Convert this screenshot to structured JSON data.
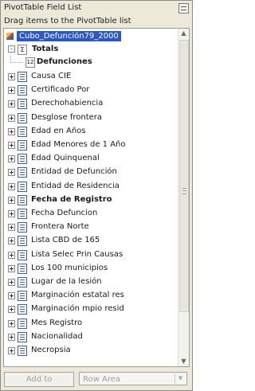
{
  "window": {
    "title": "PivotTable Field List",
    "instructions": "Drag items to the PivotTable list"
  },
  "tree": {
    "cube": "Cubo_Defunción79_2000",
    "totals": "Totals",
    "measure": "Defunciones",
    "fields": [
      {
        "label": "Causa CIE",
        "bold": false
      },
      {
        "label": "Certificado Por",
        "bold": false
      },
      {
        "label": "Derechohabiencia",
        "bold": false
      },
      {
        "label": "Desglose frontera",
        "bold": false
      },
      {
        "label": "Edad en Años",
        "bold": false
      },
      {
        "label": "Edad Menores de 1 Año",
        "bold": false
      },
      {
        "label": "Edad Quinquenal",
        "bold": false
      },
      {
        "label": "Entidad de Defunción",
        "bold": false
      },
      {
        "label": "Entidad de Residencia",
        "bold": false
      },
      {
        "label": "Fecha de Registro",
        "bold": true
      },
      {
        "label": "Fecha Defuncion",
        "bold": false
      },
      {
        "label": "Frontera Norte",
        "bold": false
      },
      {
        "label": "Lista CBD de 165",
        "bold": false
      },
      {
        "label": "Lista Selec Prin Causas",
        "bold": false
      },
      {
        "label": "Los 100 municipios",
        "bold": false
      },
      {
        "label": "Lugar de la lesión",
        "bold": false
      },
      {
        "label": "Marginación estatal res",
        "bold": false
      },
      {
        "label": "Marginación mpio resid",
        "bold": false
      },
      {
        "label": "Mes Registro",
        "bold": false
      },
      {
        "label": "Nacionalidad",
        "bold": false
      },
      {
        "label": "Necropsia",
        "bold": false
      }
    ]
  },
  "bottom": {
    "add_button": "Add to",
    "area_select": "Row Area"
  },
  "icons": {
    "close": "close-icon",
    "cube": "cube-icon",
    "totals": "sigma-icon",
    "measure": "measure-icon",
    "dimension": "dimension-icon",
    "expand": "plus-expander-icon"
  }
}
